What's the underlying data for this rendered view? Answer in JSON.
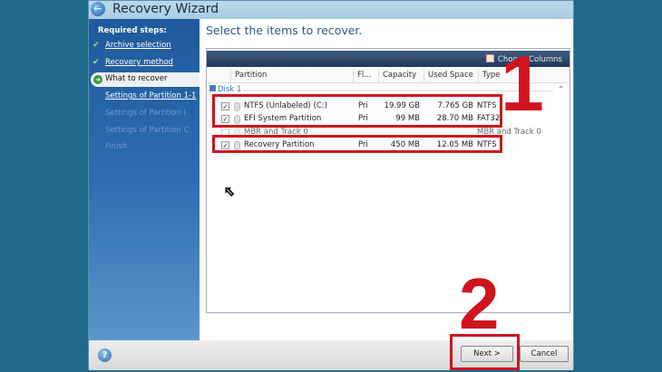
{
  "window": {
    "title": "Recovery Wizard"
  },
  "sidebar": {
    "heading": "Required steps:",
    "items": [
      {
        "label": "Archive selection",
        "state": "done"
      },
      {
        "label": "Recovery method",
        "state": "done"
      },
      {
        "label": "What to recover",
        "state": "active"
      },
      {
        "label": "Settings of Partition 1-1",
        "state": "next"
      },
      {
        "label": "Settings of Partition I",
        "state": "disabled"
      },
      {
        "label": "Settings of Partition C",
        "state": "disabled"
      },
      {
        "label": "Finish",
        "state": "disabled"
      }
    ]
  },
  "main": {
    "heading": "Select the items to recover.",
    "choose_columns": "Choose Columns",
    "columns": [
      "Partition",
      "Fl...",
      "Capacity",
      "Used Space",
      "Type"
    ],
    "disk_label": "Disk 1",
    "rows": [
      {
        "checked": true,
        "name": "NTFS (Unlabeled) (C:)",
        "flag": "Pri",
        "capacity": "19.99 GB",
        "used": "7.765 GB",
        "type": "NTFS"
      },
      {
        "checked": true,
        "name": "EFI System Partition",
        "flag": "Pri",
        "capacity": "99 MB",
        "used": "28.70 MB",
        "type": "FAT32"
      },
      {
        "checked": false,
        "name": "MBR and Track 0",
        "flag": "",
        "capacity": "",
        "used": "",
        "type": "MBR and Track 0"
      },
      {
        "checked": true,
        "name": "Recovery Partition",
        "flag": "Pri",
        "capacity": "450 MB",
        "used": "12.05 MB",
        "type": "NTFS"
      }
    ]
  },
  "footer": {
    "next": "Next >",
    "cancel": "Cancel",
    "help": "?"
  },
  "annotations": {
    "one": "1",
    "two": "2"
  }
}
